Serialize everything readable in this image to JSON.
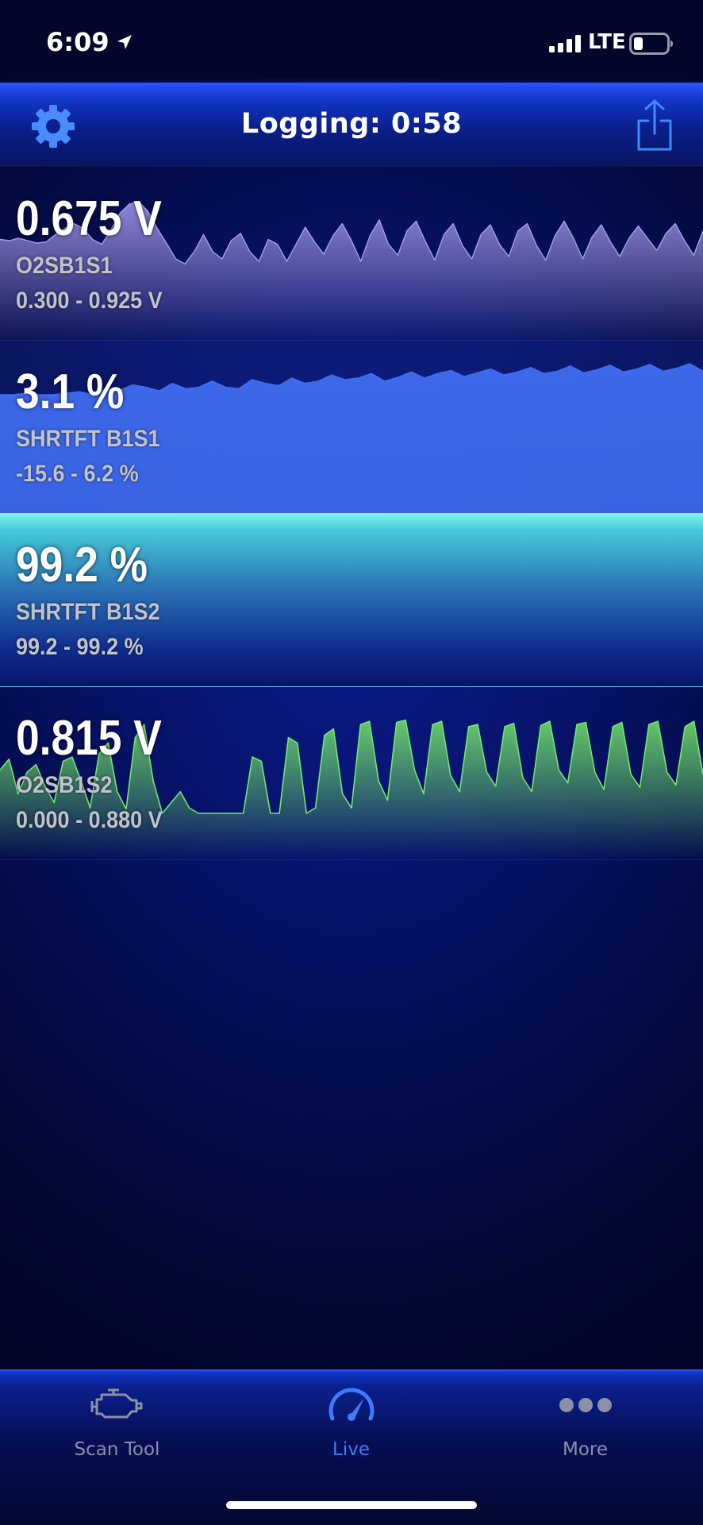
{
  "status_bar": {
    "time": "6:09",
    "network": "LTE",
    "location_icon": "location-arrow-icon",
    "signal_icon": "signal-bars-icon",
    "battery_icon": "battery-low-icon"
  },
  "nav": {
    "title": "Logging:  0:58",
    "settings_icon": "gear-icon",
    "share_icon": "share-icon"
  },
  "readings": [
    {
      "value": "0.675 V",
      "name": "O2SB1S1",
      "range": "0.300 - 0.925 V",
      "color": "#a99cf0",
      "samples": [
        0.59,
        0.58,
        0.6,
        0.58,
        0.56,
        0.57,
        0.63,
        0.68,
        0.72,
        0.68,
        0.59,
        0.55,
        0.67,
        0.81,
        0.88,
        0.9,
        0.82,
        0.68,
        0.56,
        0.43,
        0.39,
        0.49,
        0.63,
        0.49,
        0.43,
        0.58,
        0.64,
        0.49,
        0.41,
        0.59,
        0.55,
        0.41,
        0.55,
        0.69,
        0.57,
        0.47,
        0.62,
        0.72,
        0.58,
        0.41,
        0.62,
        0.75,
        0.55,
        0.46,
        0.66,
        0.74,
        0.57,
        0.42,
        0.63,
        0.72,
        0.54,
        0.43,
        0.63,
        0.71,
        0.55,
        0.45,
        0.66,
        0.72,
        0.54,
        0.42,
        0.62,
        0.74,
        0.6,
        0.43,
        0.61,
        0.71,
        0.57,
        0.45,
        0.6,
        0.7,
        0.6,
        0.5,
        0.64,
        0.72,
        0.58,
        0.46,
        0.66
      ]
    },
    {
      "value": "3.1 %",
      "name": "SHRTFT B1S1",
      "range": "-15.6 - 6.2 %",
      "color": "#3f6cf0",
      "samples": [
        0.0,
        0.0,
        0.2,
        0.0,
        0.0,
        0.2,
        0.4,
        0.0,
        0.8,
        0.6,
        1.3,
        1.0,
        0.5,
        1.5,
        0.8,
        1.0,
        1.8,
        1.0,
        0.8,
        2.0,
        1.5,
        1.2,
        2.2,
        1.5,
        1.8,
        2.6,
        2.0,
        2.2,
        2.8,
        1.8,
        2.3,
        3.0,
        2.2,
        2.8,
        3.2,
        2.4,
        2.9,
        3.4,
        2.6,
        3.0,
        3.6,
        2.8,
        3.1,
        3.8,
        2.9,
        3.3,
        3.9,
        3.0,
        3.4,
        4.0,
        3.1,
        3.5,
        4.1,
        3.1
      ]
    },
    {
      "value": "99.2 %",
      "name": "SHRTFT B1S2",
      "range": "99.2 - 99.2 %",
      "color": "#7ff6f2",
      "samples": []
    },
    {
      "value": "0.815 V",
      "name": "O2SB1S2",
      "range": "0.000 - 0.880 V",
      "color": "#74e86a",
      "samples": [
        0.4,
        0.5,
        0.18,
        0.38,
        0.45,
        0.25,
        0.1,
        0.48,
        0.52,
        0.3,
        0.05,
        0.55,
        0.65,
        0.2,
        0.04,
        0.7,
        0.82,
        0.3,
        0.0,
        0.1,
        0.2,
        0.05,
        0.0,
        0.0,
        0.0,
        0.0,
        0.0,
        0.0,
        0.52,
        0.48,
        0.0,
        0.0,
        0.7,
        0.65,
        0.0,
        0.05,
        0.72,
        0.78,
        0.18,
        0.05,
        0.82,
        0.85,
        0.3,
        0.12,
        0.84,
        0.86,
        0.4,
        0.18,
        0.82,
        0.85,
        0.35,
        0.2,
        0.8,
        0.82,
        0.38,
        0.25,
        0.8,
        0.83,
        0.33,
        0.2,
        0.81,
        0.85,
        0.4,
        0.28,
        0.82,
        0.84,
        0.38,
        0.22,
        0.8,
        0.84,
        0.36,
        0.24,
        0.82,
        0.85,
        0.38,
        0.26,
        0.8,
        0.85,
        0.36
      ]
    }
  ],
  "tabs": [
    {
      "label": "Scan Tool",
      "icon": "check-engine-icon"
    },
    {
      "label": "Live",
      "icon": "speedometer-icon"
    },
    {
      "label": "More",
      "icon": "more-dots-icon"
    }
  ]
}
